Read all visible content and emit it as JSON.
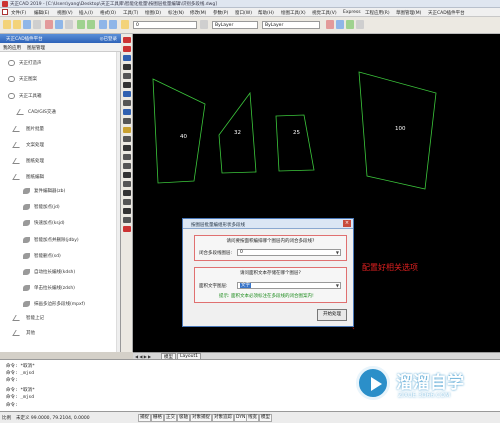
{
  "window": {
    "title": "天正CAD 2019 - [C:\\Users\\yang\\Desktop\\天正工具库\\智能化批量\\按图层批量编辑\\识别多段线.dwg]"
  },
  "menu": {
    "items": [
      "文件(F)",
      "编辑(E)",
      "视图(V)",
      "插入(I)",
      "格式(O)",
      "工具(T)",
      "绘图(D)",
      "标注(N)",
      "修改(M)",
      "参数(P)",
      "窗口(W)",
      "帮助(H)",
      "绘图工具(X)",
      "视觉工具(V)",
      "Express",
      "工程应用(R)",
      "草图管理(M)",
      "天正CAD插件平台"
    ]
  },
  "toolbar": {
    "layer_value": "0",
    "color_value": "ByLayer",
    "linetype_value": "ByLayer"
  },
  "panel": {
    "title": "天正CAD插件平台",
    "close_label": "◎已登录",
    "tabs": [
      "我的应用",
      "图层管理"
    ],
    "items": [
      {
        "label": "天正打造声",
        "icon": "cloud-icon"
      },
      {
        "label": "天正图案",
        "icon": "cloud-icon"
      },
      {
        "label": "天正工具箱",
        "icon": "cloud-icon"
      },
      {
        "label": "CAD/GIS交通",
        "icon": "plane-icon"
      },
      {
        "label": "图片批量",
        "icon": "plane-icon"
      },
      {
        "label": "文案处理",
        "icon": "plane-icon"
      },
      {
        "label": "图纸处理",
        "icon": "plane-icon"
      },
      {
        "label": "图纸编辑",
        "icon": "plane-icon"
      },
      {
        "label": "复件编辑器(zb)",
        "icon": "leaf-icon"
      },
      {
        "label": "智能加点(jd)",
        "icon": "leaf-icon"
      },
      {
        "label": "快速加点(ksjd)",
        "icon": "leaf-icon"
      },
      {
        "label": "智能加点并删除(jdby)",
        "icon": "leaf-icon"
      },
      {
        "label": "智能删点(sd)",
        "icon": "leaf-icon"
      },
      {
        "label": "自动拉长编线(kdsh)",
        "icon": "leaf-icon"
      },
      {
        "label": "单击拉长编线(zdsh)",
        "icon": "leaf-icon"
      },
      {
        "label": "抹画多边形多段线(mpxf)",
        "icon": "leaf-icon"
      },
      {
        "label": "智能上记",
        "icon": "plane-icon"
      },
      {
        "label": "其他",
        "icon": "plane-icon"
      }
    ]
  },
  "drawing": {
    "labels": [
      "40",
      "32",
      "25",
      "100"
    ],
    "line_color": "#3cc83c"
  },
  "dialog": {
    "title": "按图层批量编组形状多段线",
    "close_icon": "×",
    "group1_title": "请问要按面积编排哪个图层内的闭合多段线?",
    "group1_field_label": "闭合多段线图层:",
    "group1_field_value": "0",
    "group2_title": "请问面积文本存储在哪个图层?",
    "group2_field_label": "面积文字图层:",
    "group2_field_value": "文字",
    "hint": "提示: 面积文本必须标注在多段线的闭合图案内!",
    "ok_button": "开始处理"
  },
  "annotation": "配置好相关选项",
  "layout_tabs": {
    "nav": "◀ ◀ ▶ ▶",
    "tabs": [
      "模型",
      "Layout1"
    ]
  },
  "command": {
    "lines": [
      "命令: *取消*",
      "命令:   _mjsd",
      "命令:",
      "命令: *取消*",
      "命令:   _mjsd",
      "命令:"
    ]
  },
  "status": {
    "scale": "比例",
    "coords": "未定义 99.0000, 79.2104, 0.0000",
    "toggles": [
      "捕捉",
      "栅格",
      "正交",
      "极轴",
      "对象捕捉",
      "对象追踪",
      "DYN",
      "线宽",
      "模型"
    ]
  },
  "watermark": {
    "text": "溜溜自学",
    "url": "ZIXUE.3D66.COM"
  }
}
